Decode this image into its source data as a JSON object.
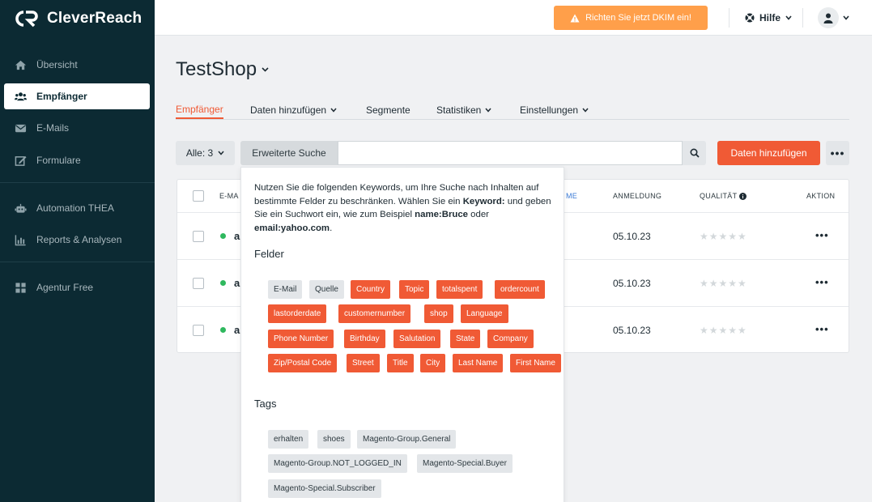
{
  "brand": {
    "name": "CleverReach"
  },
  "sidebar": {
    "items": [
      {
        "label": "Übersicht",
        "icon": "home-icon"
      },
      {
        "label": "Empfänger",
        "icon": "users-icon",
        "active": true
      },
      {
        "label": "E-Mails",
        "icon": "mail-icon"
      },
      {
        "label": "Formulare",
        "icon": "edit-icon"
      },
      {
        "label": "Automation THEA",
        "icon": "robot-icon"
      },
      {
        "label": "Reports & Analysen",
        "icon": "bar-chart-icon"
      },
      {
        "label": "Agentur Free",
        "icon": "grid-icon"
      }
    ]
  },
  "topbar": {
    "dkim_label": "Richten Sie jetzt DKIM ein!",
    "help_label": "Hilfe"
  },
  "page": {
    "title": "TestShop",
    "tabs": [
      {
        "label": "Empfänger",
        "active": true
      },
      {
        "label": "Daten hinzufügen",
        "dropdown": true
      },
      {
        "label": "Segmente"
      },
      {
        "label": "Statistiken",
        "dropdown": true
      },
      {
        "label": "Einstellungen",
        "dropdown": true
      }
    ]
  },
  "toolbar": {
    "filter_label": "Alle: 3",
    "advanced_search_label": "Erweiterte Suche",
    "search_value": "",
    "add_data_label": "Daten hinzufügen",
    "more_label": "•••"
  },
  "table": {
    "headers": {
      "email": "E-MA",
      "name_frag": "ME",
      "signup": "ANMELDUNG",
      "quality": "QUALITÄT",
      "action": "AKTION"
    },
    "rows": [
      {
        "email_fragment": "a",
        "date": "05.10.23",
        "stars": "★★★★★",
        "action": "•••"
      },
      {
        "email_fragment": "a",
        "date": "05.10.23",
        "stars": "★★★★★",
        "action": "•••"
      },
      {
        "email_fragment": "a",
        "date": "05.10.23",
        "stars": "★★★★★",
        "action": "•••"
      }
    ]
  },
  "popover": {
    "intro_1": "Nutzen Sie die folgenden Keywords, um Ihre Suche nach Inhalten auf bestimmte Felder zu beschränken. Wählen Sie ein ",
    "intro_keyword": "Keyword:",
    "intro_2": " und geben Sie ein Suchwort ein, wie zum Beispiel ",
    "intro_example_1": "name:Bruce",
    "intro_3": " oder ",
    "intro_example_2": "email:yahoo.com",
    "intro_4": ".",
    "fields_title": "Felder",
    "fields": [
      {
        "label": "E-Mail",
        "style": "grey"
      },
      {
        "label": "Quelle",
        "style": "grey"
      },
      {
        "label": "Country",
        "style": "orange"
      },
      {
        "label": "Topic",
        "style": "orange"
      },
      {
        "label": "totalspent",
        "style": "orange"
      },
      {
        "label": "ordercount",
        "style": "orange"
      },
      {
        "label": "lastorderdate",
        "style": "orange"
      },
      {
        "label": "customernumber",
        "style": "orange"
      },
      {
        "label": "shop",
        "style": "orange"
      },
      {
        "label": "Language",
        "style": "orange"
      },
      {
        "label": "Phone Number",
        "style": "orange"
      },
      {
        "label": "Birthday",
        "style": "orange"
      },
      {
        "label": "Salutation",
        "style": "orange"
      },
      {
        "label": "State",
        "style": "orange"
      },
      {
        "label": "Company",
        "style": "orange"
      },
      {
        "label": "Zip/Postal Code",
        "style": "orange"
      },
      {
        "label": "Street",
        "style": "orange"
      },
      {
        "label": "Title",
        "style": "orange"
      },
      {
        "label": "City",
        "style": "orange"
      },
      {
        "label": "Last Name",
        "style": "orange"
      },
      {
        "label": "First Name",
        "style": "orange"
      }
    ],
    "tags_title": "Tags",
    "tags": [
      {
        "label": "erhalten"
      },
      {
        "label": "shoes"
      },
      {
        "label": "Magento-Group.General"
      },
      {
        "label": "Magento-Group.NOT_LOGGED_IN"
      },
      {
        "label": "Magento-Special.Buyer"
      },
      {
        "label": "Magento-Special.Subscriber"
      }
    ]
  },
  "colors": {
    "sidebar_bg": "#0c2a33",
    "accent": "#f05a35",
    "dkim": "#ff9f4a",
    "online_dot": "#2fb85e"
  }
}
